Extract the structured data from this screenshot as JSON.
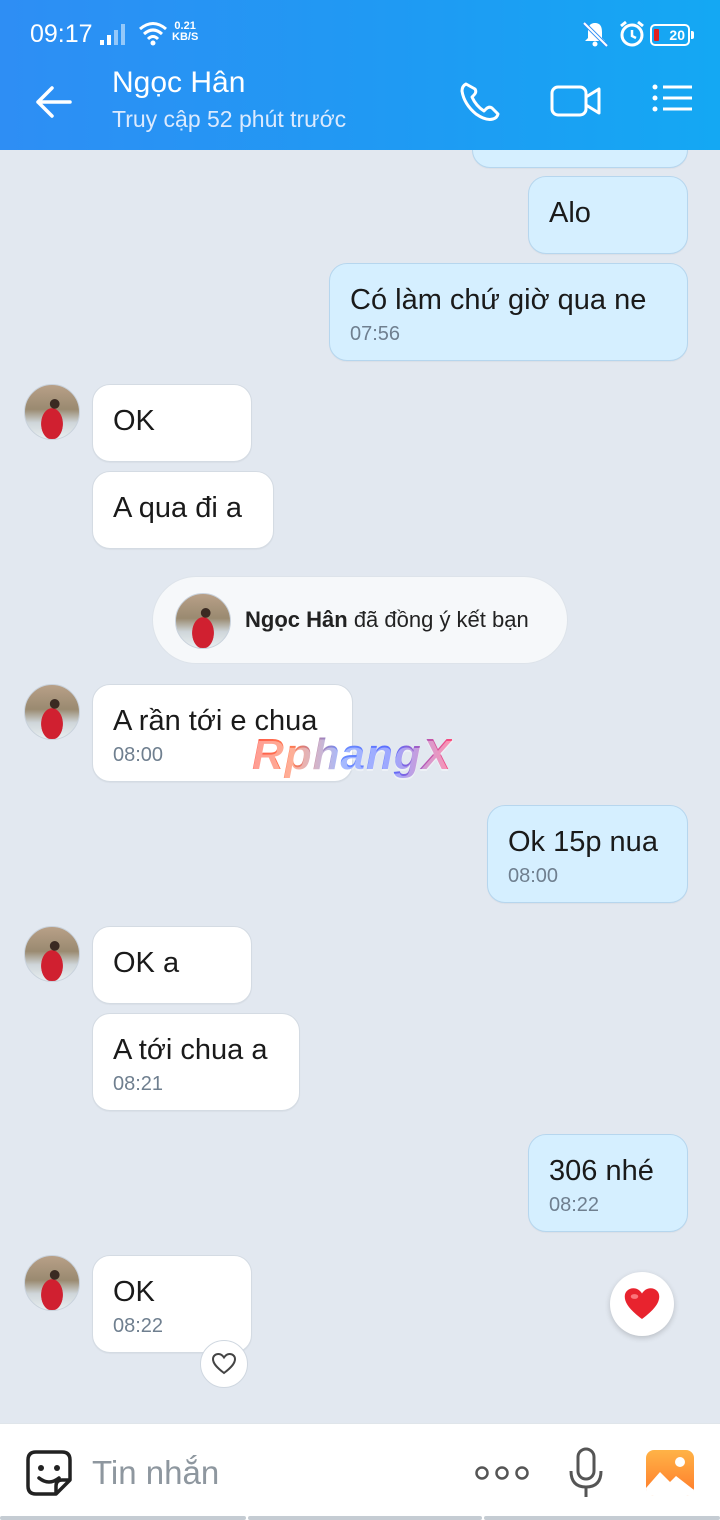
{
  "status_bar": {
    "time": "09:17",
    "net_speed_value": "0.21",
    "net_speed_unit": "KB/S",
    "battery": "20"
  },
  "header": {
    "contact_name": "Ngọc Hân",
    "contact_status": "Truy cập 52 phút trước",
    "icons": [
      "back-arrow-icon",
      "phone-icon",
      "video-camera-icon",
      "list-menu-icon"
    ]
  },
  "messages": [
    {
      "side": "out",
      "text": "Alo",
      "time": ""
    },
    {
      "side": "out",
      "text": "Có làm chứ giờ qua ne",
      "time": "07:56"
    },
    {
      "side": "in",
      "text": "OK",
      "time": ""
    },
    {
      "side": "in",
      "text": "A qua đi a",
      "time": ""
    },
    {
      "side": "in",
      "text": "A rần tới e chua",
      "time": "08:00"
    },
    {
      "side": "out",
      "text": "Ok 15p nua",
      "time": "08:00"
    },
    {
      "side": "in",
      "text": "OK a",
      "time": ""
    },
    {
      "side": "in",
      "text": "A tới chua a",
      "time": "08:21"
    },
    {
      "side": "out",
      "text": "306 nhé",
      "time": "08:22"
    },
    {
      "side": "in",
      "text": "OK",
      "time": "08:22"
    }
  ],
  "system_notice": {
    "name": "Ngọc Hân",
    "text": "đã đồng ý kết bạn"
  },
  "watermark": "RphangX",
  "composer": {
    "placeholder": "Tin nhắn"
  },
  "colors": {
    "header_start": "#2e8ef4",
    "header_end": "#14a8f3",
    "outgoing_bubble": "#d5efff",
    "incoming_bubble": "#ffffff",
    "chat_background": "#e2e8f0",
    "heart": "#e8232e"
  }
}
